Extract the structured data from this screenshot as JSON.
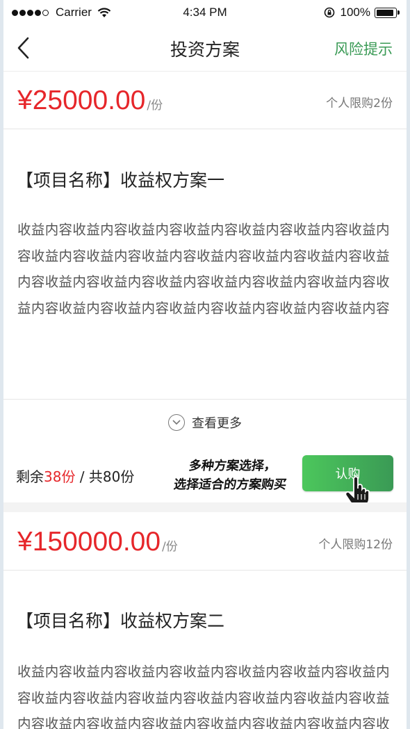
{
  "status": {
    "carrier": "Carrier",
    "time": "4:34 PM",
    "battery": "100%"
  },
  "nav": {
    "title": "投资方案",
    "risk": "风险提示"
  },
  "plans": [
    {
      "price": "¥25000.00",
      "unit": "/份",
      "limit": "个人限购2份",
      "title": "【项目名称】收益权方案一",
      "desc": "收益内容收益内容收益内容收益内容收益内容收益内容收益内容收益内容收益内容收益内容收益内容收益内容收益内容收益内容收益内容收益内容收益内容收益内容收益内容收益内容收益内容收益内容收益内容收益内容收益内容收益内容收益内容"
    },
    {
      "price": "¥150000.00",
      "unit": "/份",
      "limit": "个人限购12份",
      "title": "【项目名称】收益权方案二",
      "desc": "收益内容收益内容收益内容收益内容收益内容收益内容收益内容收益内容收益内容收益内容收益内容收益内容收益内容收益内容收益内容收益内容收益内容收益内容收益内容收益内容收益内容收益内容收益内容收益内容收益内容收益内容收益内容"
    }
  ],
  "more": "查看更多",
  "buy": {
    "remain_label": "剩余",
    "remain_count": "38份",
    "total": " / 共80份",
    "button": "认购",
    "note_line1": "多种方案选择，",
    "note_line2": "选择适合的方案购买"
  },
  "icons": {
    "back": "back-chevron-icon",
    "more": "chevron-down-icon",
    "hand": "pointer-hand-icon"
  },
  "colors": {
    "accent_green": "#3a9a55",
    "price_red": "#e6262a"
  }
}
